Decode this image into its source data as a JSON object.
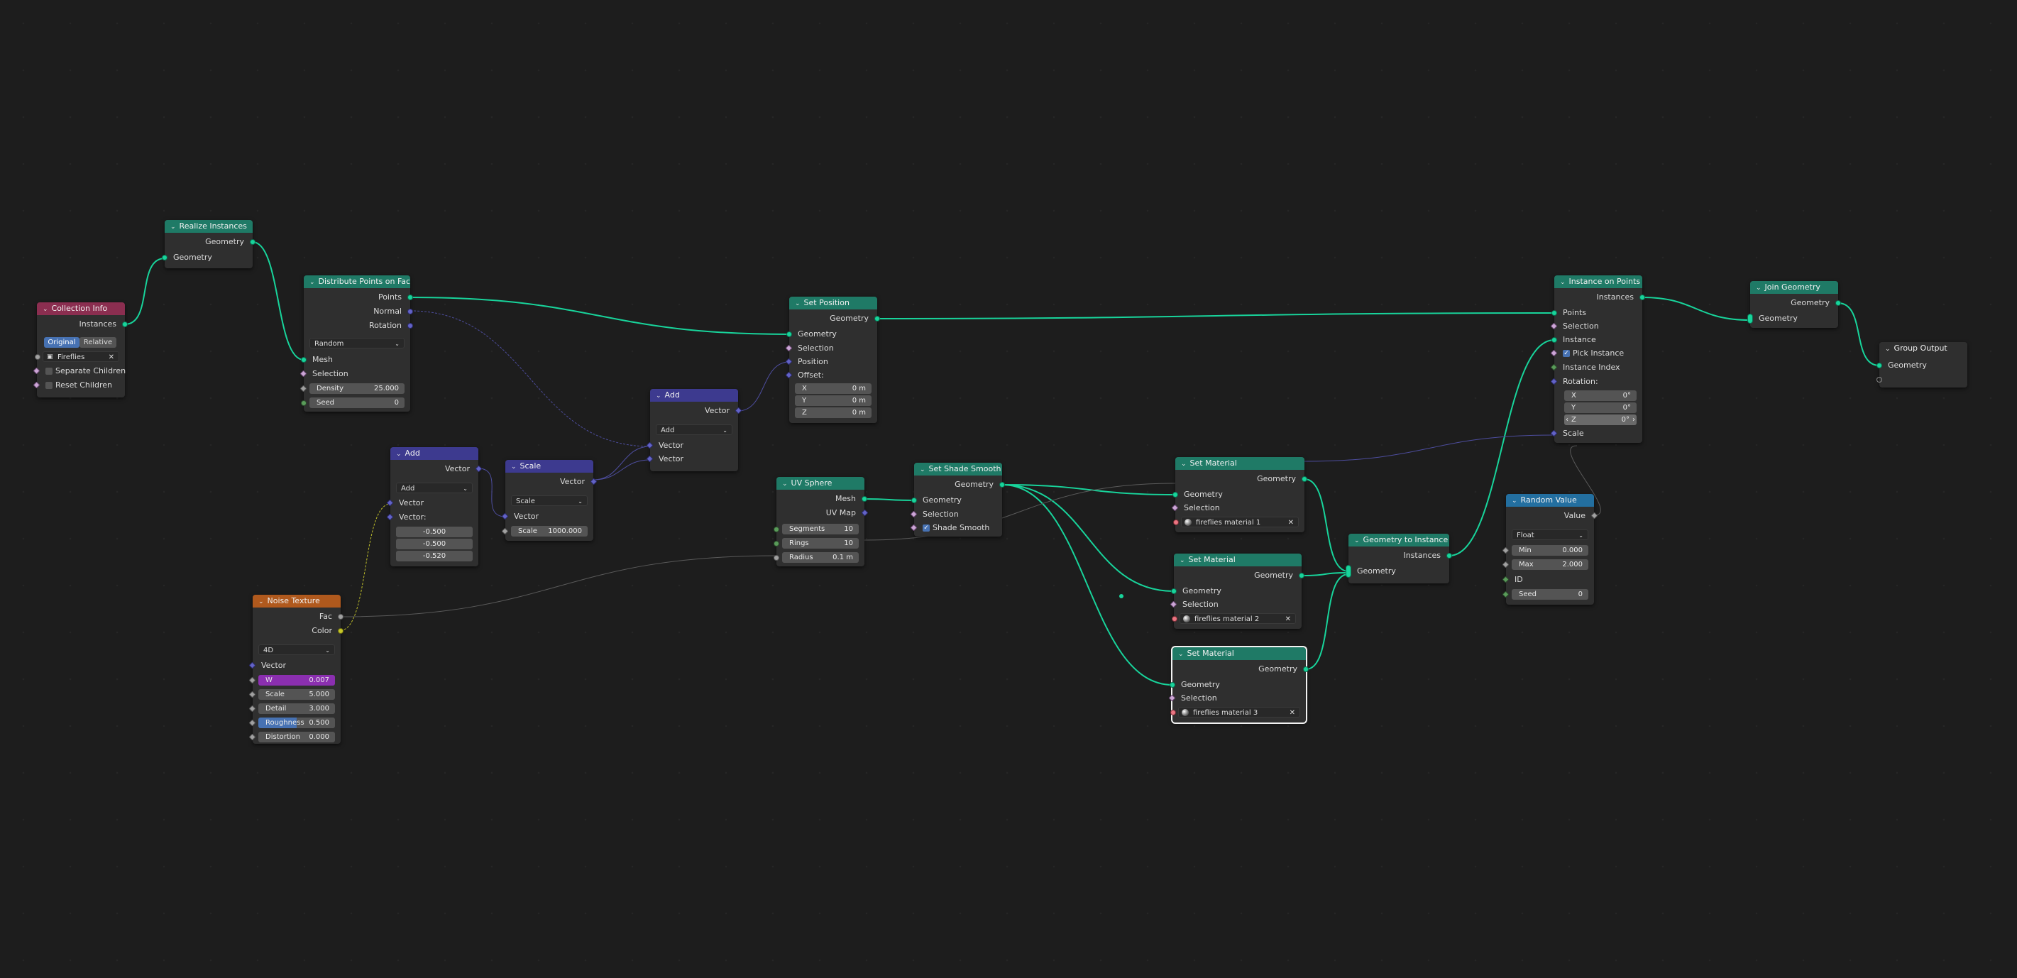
{
  "nodes": {
    "collection_info": {
      "title": "Collection Info",
      "out_instances": "Instances",
      "mode_original": "Original",
      "mode_relative": "Relative",
      "collection": "Fireflies",
      "separate_children": "Separate Children",
      "reset_children": "Reset Children"
    },
    "realize_instances": {
      "title": "Realize Instances",
      "out_geometry": "Geometry",
      "in_geometry": "Geometry"
    },
    "distribute_points": {
      "title": "Distribute Points on Faces",
      "out_points": "Points",
      "out_normal": "Normal",
      "out_rotation": "Rotation",
      "mode": "Random",
      "in_mesh": "Mesh",
      "in_selection": "Selection",
      "density_label": "Density",
      "density_value": "25.000",
      "seed_label": "Seed",
      "seed_value": "0"
    },
    "set_position": {
      "title": "Set Position",
      "out_geometry": "Geometry",
      "in_geometry": "Geometry",
      "in_selection": "Selection",
      "in_position": "Position",
      "in_offset": "Offset:",
      "x_label": "X",
      "x_value": "0 m",
      "y_label": "Y",
      "y_value": "0 m",
      "z_label": "Z",
      "z_value": "0 m"
    },
    "add_top": {
      "title": "Add",
      "out_vector": "Vector",
      "op": "Add",
      "in_vector1": "Vector",
      "in_vector2": "Vector"
    },
    "add_left": {
      "title": "Add",
      "out_vector": "Vector",
      "op": "Add",
      "in_vector1": "Vector",
      "in_vector2": "Vector:",
      "v1": "-0.500",
      "v2": "-0.500",
      "v3": "-0.520"
    },
    "scale": {
      "title": "Scale",
      "out_vector": "Vector",
      "op": "Scale",
      "in_vector": "Vector",
      "scale_label": "Scale",
      "scale_value": "1000.000"
    },
    "noise": {
      "title": "Noise Texture",
      "out_fac": "Fac",
      "out_color": "Color",
      "dimensions": "4D",
      "in_vector": "Vector",
      "w_label": "W",
      "w_value": "0.007",
      "scale_label": "Scale",
      "scale_value": "5.000",
      "detail_label": "Detail",
      "detail_value": "3.000",
      "rough_label": "Roughness",
      "rough_value": "0.500",
      "dist_label": "Distortion",
      "dist_value": "0.000"
    },
    "uv_sphere": {
      "title": "UV Sphere",
      "out_mesh": "Mesh",
      "out_uvmap": "UV Map",
      "seg_label": "Segments",
      "seg_value": "10",
      "rings_label": "Rings",
      "rings_value": "10",
      "radius_label": "Radius",
      "radius_value": "0.1 m"
    },
    "shade_smooth": {
      "title": "Set Shade Smooth",
      "out_geometry": "Geometry",
      "in_geometry": "Geometry",
      "in_selection": "Selection",
      "in_shade": "Shade Smooth"
    },
    "set_material_1": {
      "title": "Set Material",
      "out_geometry": "Geometry",
      "in_geometry": "Geometry",
      "in_selection": "Selection",
      "material": "fireflies material 1"
    },
    "set_material_2": {
      "title": "Set Material",
      "out_geometry": "Geometry",
      "in_geometry": "Geometry",
      "in_selection": "Selection",
      "material": "fireflies material 2"
    },
    "set_material_3": {
      "title": "Set Material",
      "out_geometry": "Geometry",
      "in_geometry": "Geometry",
      "in_selection": "Selection",
      "material": "fireflies material 3"
    },
    "geo_to_instance": {
      "title": "Geometry to Instance",
      "out_instances": "Instances",
      "in_geometry": "Geometry"
    },
    "instance_on_points": {
      "title": "Instance on Points",
      "out_instances": "Instances",
      "in_points": "Points",
      "in_selection": "Selection",
      "in_instance": "Instance",
      "in_pick": "Pick Instance",
      "in_index": "Instance Index",
      "in_rotation": "Rotation:",
      "x_label": "X",
      "x_value": "0°",
      "y_label": "Y",
      "y_value": "0°",
      "z_label": "Z",
      "z_value": "0°",
      "in_scale": "Scale"
    },
    "random_value": {
      "title": "Random Value",
      "out_value": "Value",
      "type": "Float",
      "min_label": "Min",
      "min_value": "0.000",
      "max_label": "Max",
      "max_value": "2.000",
      "in_id": "ID",
      "seed_label": "Seed",
      "seed_value": "0"
    },
    "join_geometry": {
      "title": "Join Geometry",
      "out_geometry": "Geometry",
      "in_geometry": "Geometry"
    },
    "group_output": {
      "title": "Group Output",
      "in_geometry": "Geometry"
    }
  },
  "colors": {
    "geometry_socket": "#18d49b",
    "vector_socket": "#6363c7",
    "geometry_header": "#1f7a66",
    "input_header": "#8b2e50",
    "vector_header": "#3d3a8f",
    "texture_header": "#b0591d",
    "utility_header": "#236fa0"
  }
}
